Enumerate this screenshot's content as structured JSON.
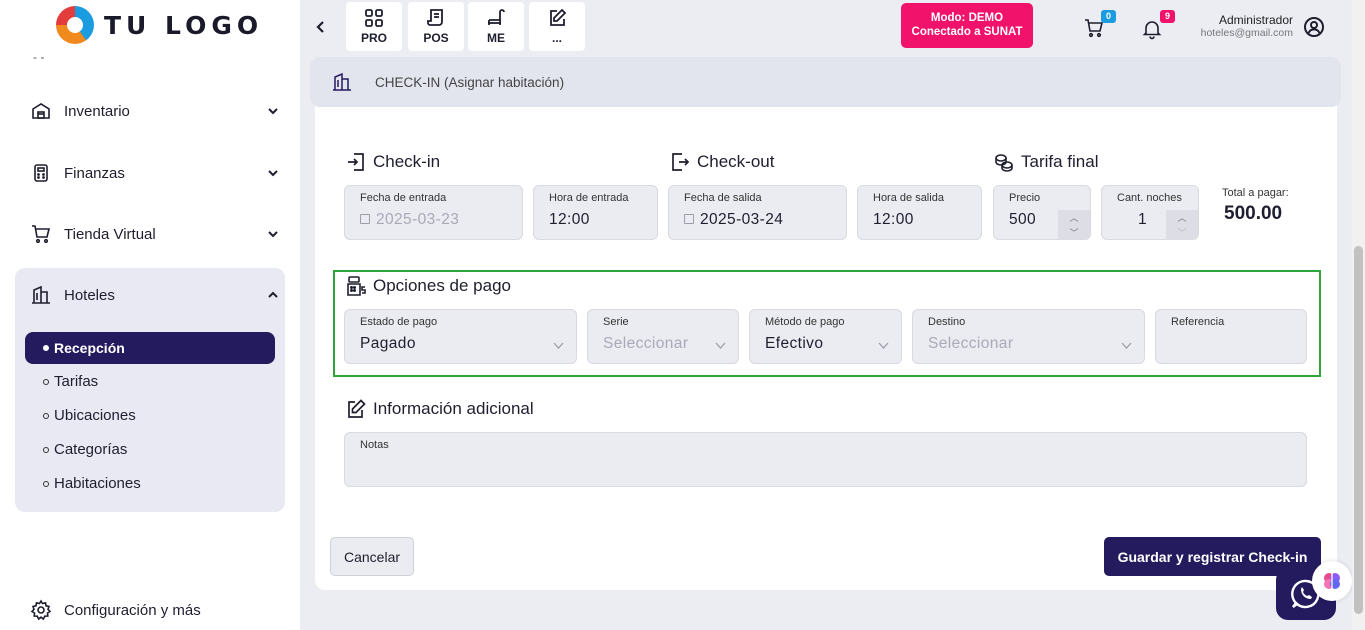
{
  "logo": {
    "text": "TU LOGO"
  },
  "sidebar": {
    "items": [
      {
        "label": "Inventario",
        "icon": "warehouse-icon"
      },
      {
        "label": "Finanzas",
        "icon": "calculator-icon"
      },
      {
        "label": "Tienda Virtual",
        "icon": "cart-icon"
      },
      {
        "label": "Hoteles",
        "icon": "building-icon"
      }
    ],
    "hotel_sub": [
      "Recepción",
      "Tarifas",
      "Ubicaciones",
      "Categorías",
      "Habitaciones"
    ],
    "config_label": "Configuración y más"
  },
  "toolbar": {
    "buttons": [
      {
        "label": "PRO",
        "icon": "grid-icon"
      },
      {
        "label": "POS",
        "icon": "receipt-icon"
      },
      {
        "label": "ME",
        "icon": "bench-icon"
      },
      {
        "label": "...",
        "icon": "edit-icon"
      }
    ]
  },
  "demo": {
    "line1": "Modo: DEMO",
    "line2": "Conectado a SUNAT"
  },
  "cart_count": "0",
  "notif_count": "9",
  "user": {
    "name": "Administrador",
    "email": "hoteles@gmail.com"
  },
  "page": {
    "title": "CHECK-IN (Asignar habitación)"
  },
  "checkin": {
    "title": "Check-in",
    "date_label": "Fecha de entrada",
    "date_value": "2025-03-23",
    "time_label": "Hora de entrada",
    "time_value": "12:00"
  },
  "checkout": {
    "title": "Check-out",
    "date_label": "Fecha de salida",
    "date_value": "2025-03-24",
    "time_label": "Hora de salida",
    "time_value": "12:00"
  },
  "tarifa": {
    "title": "Tarifa final",
    "price_label": "Precio",
    "price_value": "500",
    "nights_label": "Cant. noches",
    "nights_value": "1",
    "total_label": "Total a pagar:",
    "total_value": "500.00"
  },
  "payment": {
    "title": "Opciones de pago",
    "estado_label": "Estado de pago",
    "estado_value": "Pagado",
    "serie_label": "Serie",
    "serie_placeholder": "Seleccionar",
    "metodo_label": "Método de pago",
    "metodo_value": "Efectivo",
    "destino_label": "Destino",
    "destino_placeholder": "Seleccionar",
    "referencia_label": "Referencia"
  },
  "additional": {
    "title": "Información adicional",
    "notes_label": "Notas"
  },
  "actions": {
    "cancel": "Cancelar",
    "save": "Guardar y registrar Check-in"
  },
  "colors": {
    "primary": "#241a5e",
    "demo": "#f0126b",
    "accent_border": "#2ea43a"
  }
}
